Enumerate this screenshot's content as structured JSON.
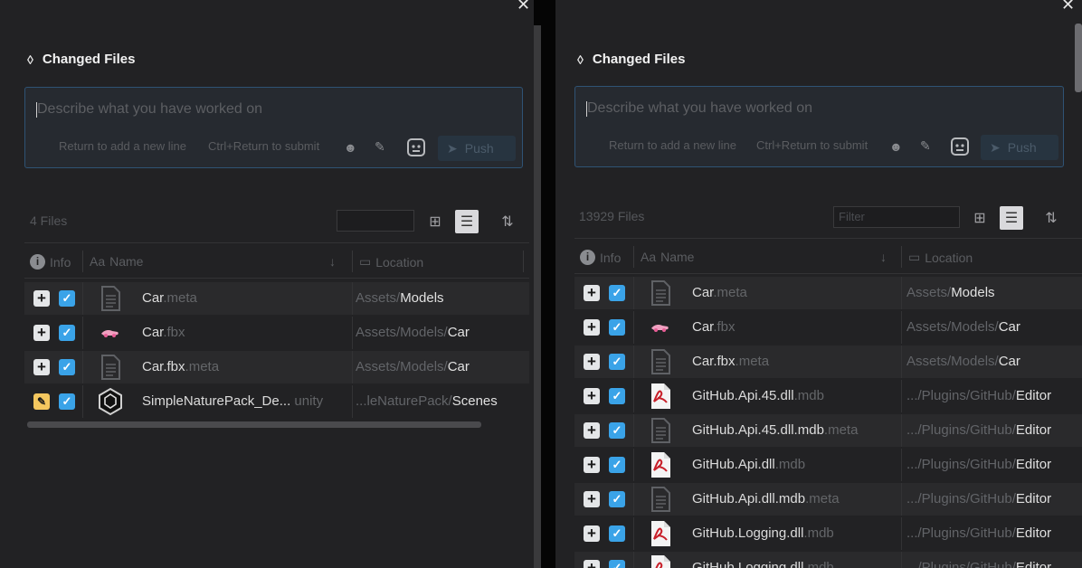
{
  "left_panel": {
    "close_glyph": "✕",
    "header": "Changed Files",
    "commit_placeholder": "Describe what you have worked on",
    "hint_newline": "Return to add a new line",
    "hint_submit": "Ctrl+Return to submit",
    "push_label": "Push",
    "files_count": "4 Files",
    "filter_placeholder": "",
    "columns": {
      "info": "Info",
      "name": "Name",
      "location": "Location"
    },
    "files": [
      {
        "status": "added",
        "name": "Car",
        "ext": ".meta",
        "icon": "meta-file-icon",
        "path": "Assets/",
        "leaf": "Models"
      },
      {
        "status": "added",
        "name": "Car",
        "ext": ".fbx",
        "icon": "car-model-icon",
        "path": "Assets/Models/",
        "leaf": "Car"
      },
      {
        "status": "added",
        "name": "Car.fbx",
        "ext": ".meta",
        "icon": "meta-file-icon",
        "path": "Assets/Models/",
        "leaf": "Car"
      },
      {
        "status": "modified",
        "name": "SimpleNaturePack_De...",
        "ext": "unity",
        "icon": "unity-scene-icon",
        "path": "...leNaturePack/",
        "leaf": "Scenes"
      }
    ]
  },
  "right_panel": {
    "close_glyph": "✕",
    "header": "Changed Files",
    "commit_placeholder": "Describe what you have worked on",
    "hint_newline": "Return to add a new line",
    "hint_submit": "Ctrl+Return to submit",
    "push_label": "Push",
    "files_count": "13929 Files",
    "filter_placeholder": "Filter",
    "columns": {
      "info": "Info",
      "name": "Name",
      "location": "Location"
    },
    "files": [
      {
        "status": "added",
        "name": "Car",
        "ext": ".meta",
        "icon": "meta-file-icon",
        "path": "Assets/",
        "leaf": "Models"
      },
      {
        "status": "added",
        "name": "Car",
        "ext": ".fbx",
        "icon": "car-model-icon",
        "path": "Assets/Models/",
        "leaf": "Car"
      },
      {
        "status": "added",
        "name": "Car.fbx",
        "ext": ".meta",
        "icon": "meta-file-icon",
        "path": "Assets/Models/",
        "leaf": "Car"
      },
      {
        "status": "added",
        "name": "GitHub.Api.45.dll",
        "ext": ".mdb",
        "icon": "pdf-file-icon",
        "path": ".../Plugins/GitHub/",
        "leaf": "Editor"
      },
      {
        "status": "added",
        "name": "GitHub.Api.45.dll.mdb",
        "ext": ".meta",
        "icon": "meta-file-icon",
        "path": ".../Plugins/GitHub/",
        "leaf": "Editor"
      },
      {
        "status": "added",
        "name": "GitHub.Api.dll",
        "ext": ".mdb",
        "icon": "pdf-file-icon",
        "path": ".../Plugins/GitHub/",
        "leaf": "Editor"
      },
      {
        "status": "added",
        "name": "GitHub.Api.dll.mdb",
        "ext": ".meta",
        "icon": "meta-file-icon",
        "path": ".../Plugins/GitHub/",
        "leaf": "Editor"
      },
      {
        "status": "added",
        "name": "GitHub.Logging.dll",
        "ext": ".mdb",
        "icon": "pdf-file-icon",
        "path": ".../Plugins/GitHub/",
        "leaf": "Editor"
      },
      {
        "status": "added",
        "name": "GitHub.Logging.dll",
        "ext": ".mdb",
        "icon": "pdf-file-icon",
        "path": ".../Plugins/GitHub/",
        "leaf": "Editor"
      }
    ]
  }
}
